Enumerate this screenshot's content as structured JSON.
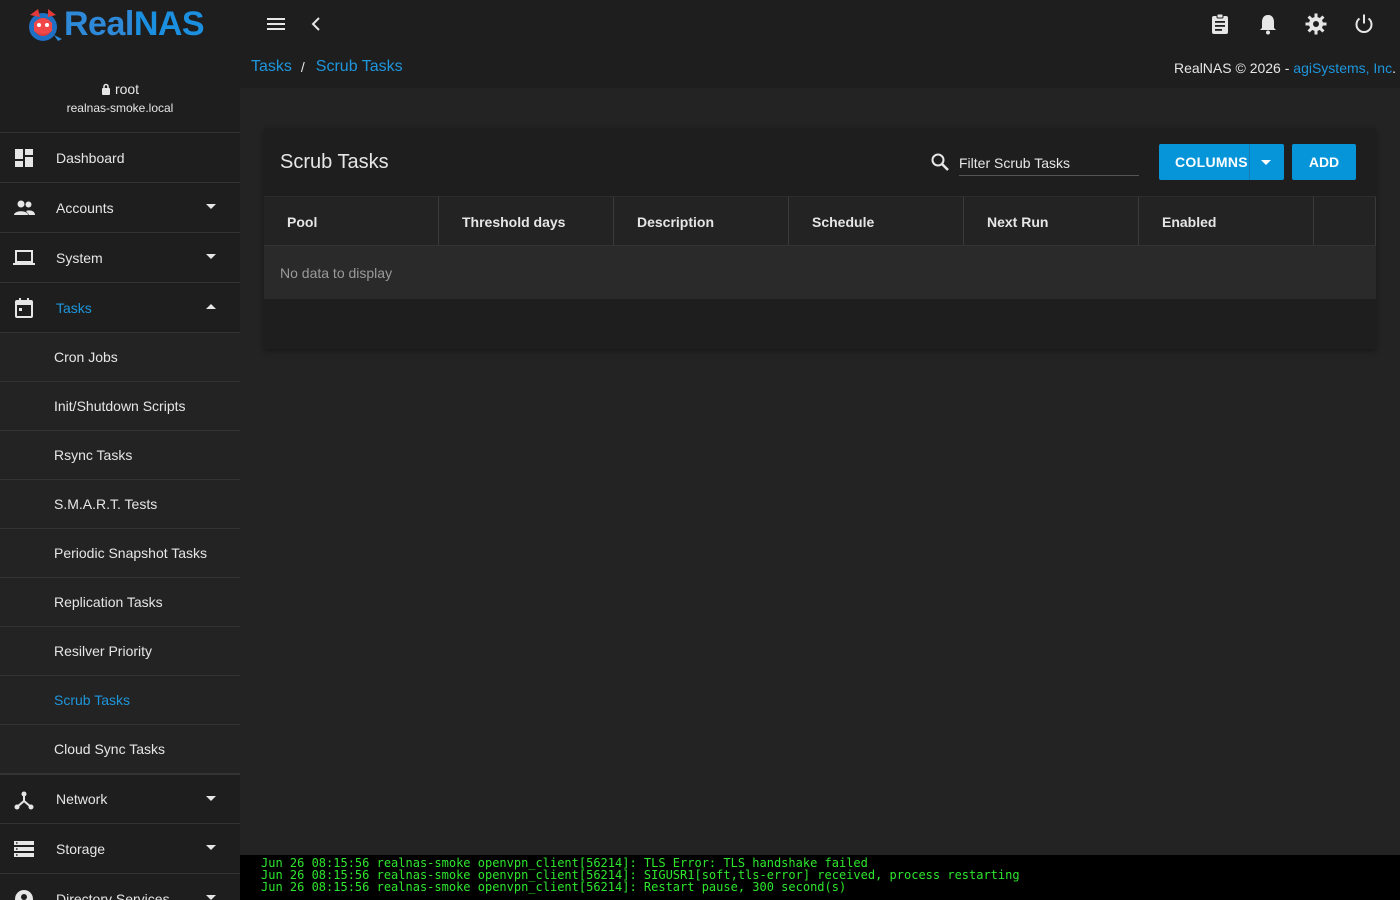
{
  "app": {
    "logo_part1": "Real",
    "logo_part2": "NAS"
  },
  "topbar": {
    "icons": [
      "menu-icon",
      "chevron-left-icon",
      "clipboard-icon",
      "bell-icon",
      "gear-icon",
      "power-icon"
    ]
  },
  "user": {
    "name": "root",
    "host": "realnas-smoke.local"
  },
  "sidebar": {
    "items": [
      {
        "label": "Dashboard",
        "icon": "dashboard-icon"
      },
      {
        "label": "Accounts",
        "icon": "people-icon"
      },
      {
        "label": "System",
        "icon": "laptop-icon"
      },
      {
        "label": "Tasks",
        "icon": "calendar-icon"
      },
      {
        "label": "Network",
        "icon": "network-icon"
      },
      {
        "label": "Storage",
        "icon": "storage-icon"
      },
      {
        "label": "Directory Services",
        "icon": "directory-icon"
      }
    ],
    "task_children": [
      "Cron Jobs",
      "Init/Shutdown Scripts",
      "Rsync Tasks",
      "S.M.A.R.T. Tests",
      "Periodic Snapshot Tasks",
      "Replication Tasks",
      "Resilver Priority",
      "Scrub Tasks",
      "Cloud Sync Tasks"
    ],
    "active_child": "Scrub Tasks"
  },
  "breadcrumb": {
    "parent": "Tasks",
    "separator": "/",
    "current": "Scrub Tasks"
  },
  "copyright": {
    "text": "RealNAS © 2026 - ",
    "company": "agiSystems, Inc",
    "suffix": "."
  },
  "card": {
    "title": "Scrub Tasks",
    "filter_placeholder": "Filter Scrub Tasks",
    "columns_button": "COLUMNS",
    "add_button": "ADD",
    "columns": [
      "Pool",
      "Threshold days",
      "Description",
      "Schedule",
      "Next Run",
      "Enabled"
    ],
    "empty_message": "No data to display"
  },
  "console": {
    "lines": [
      "Jun 26 08:15:56 realnas-smoke openvpn_client[56214]: TLS Error: TLS handshake failed",
      "Jun 26 08:15:56 realnas-smoke openvpn_client[56214]: SIGUSR1[soft,tls-error] received, process restarting",
      "Jun 26 08:15:56 realnas-smoke openvpn_client[56214]: Restart pause, 300 second(s)"
    ]
  },
  "colors": {
    "accent": "#1e96dc",
    "button": "#0795d9",
    "console_text": "#2ee62e"
  }
}
